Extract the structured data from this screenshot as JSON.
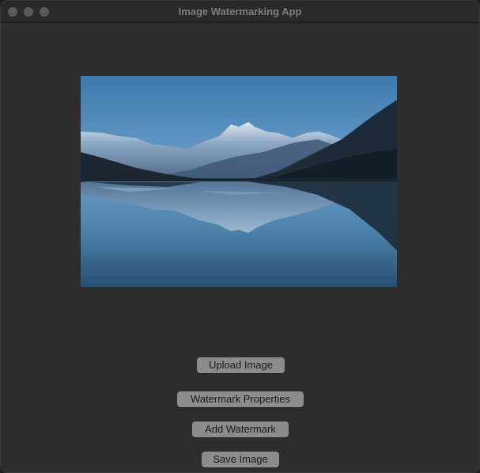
{
  "window": {
    "title": "Image Watermarking App"
  },
  "image_preview": {
    "description_icon": "landscape-photo"
  },
  "buttons": {
    "upload": "Upload Image",
    "watermark_properties": "Watermark Properties",
    "add_watermark": "Add Watermark",
    "save": "Save Image"
  },
  "colors": {
    "window_bg": "#2d2d2d",
    "button_bg": "#8c8c8c",
    "title_text": "#7e7e7e"
  }
}
